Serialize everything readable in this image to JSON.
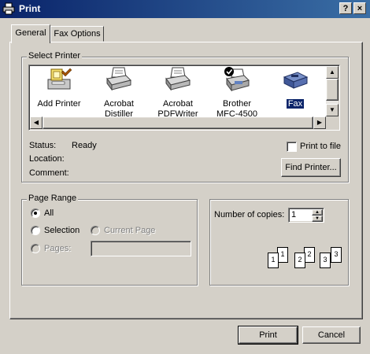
{
  "window": {
    "title": "Print",
    "help_button": "?",
    "close_button": "×"
  },
  "tabs": [
    {
      "label": "General",
      "active": true
    },
    {
      "label": "Fax Options",
      "active": false
    }
  ],
  "select_printer": {
    "group_label": "Select Printer",
    "printers": [
      {
        "line1": "Add Printer",
        "line2": "",
        "icon": "add-printer-icon"
      },
      {
        "line1": "Acrobat",
        "line2": "Distiller",
        "icon": "printer-icon"
      },
      {
        "line1": "Acrobat",
        "line2": "PDFWriter",
        "icon": "printer-icon"
      },
      {
        "line1": "Brother",
        "line2": "MFC-4500",
        "icon": "default-printer-icon"
      },
      {
        "line1": "Fax",
        "line2": "",
        "icon": "fax-icon",
        "selected": true
      }
    ],
    "status_label": "Status:",
    "status_value": "Ready",
    "location_label": "Location:",
    "comment_label": "Comment:",
    "print_to_file_label": "Print to file",
    "print_to_file_checked": false,
    "find_printer_button": "Find Printer..."
  },
  "page_range": {
    "group_label": "Page Range",
    "options": [
      {
        "label": "All",
        "selected": true,
        "enabled": true
      },
      {
        "label": "Selection",
        "selected": false,
        "enabled": true
      },
      {
        "label": "Current Page",
        "selected": false,
        "enabled": false
      },
      {
        "label": "Pages:",
        "selected": false,
        "enabled": false
      }
    ],
    "pages_value": ""
  },
  "copies": {
    "label": "Number of copies:",
    "value": "1",
    "collate_page_numbers": [
      "1",
      "1",
      "2",
      "2",
      "3",
      "3"
    ]
  },
  "footer": {
    "print_button": "Print",
    "cancel_button": "Cancel"
  },
  "colors": {
    "titlebar_start": "#0a246a",
    "titlebar_end": "#3a6ea5",
    "selection": "#0a246a",
    "face": "#d4d0c8"
  }
}
